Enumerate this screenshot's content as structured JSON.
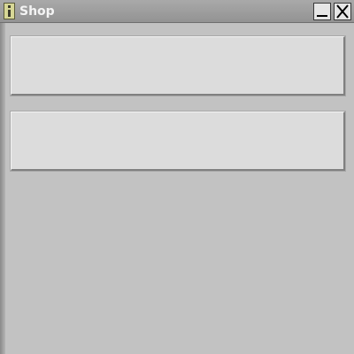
{
  "window": {
    "title": "Shop",
    "icons": {
      "app": "info-icon",
      "minimize": "minimize-icon",
      "close": "close-icon"
    }
  },
  "panels": [
    {
      "label": ""
    },
    {
      "label": ""
    }
  ]
}
